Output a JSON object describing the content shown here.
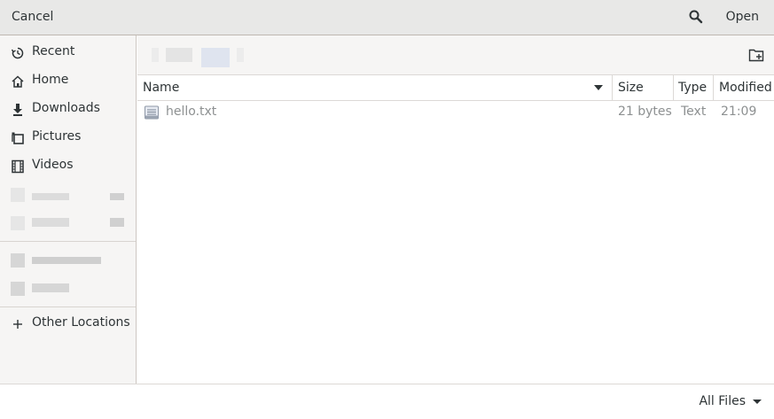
{
  "header": {
    "cancel_label": "Cancel",
    "open_label": "Open"
  },
  "sidebar": {
    "items": [
      {
        "label": "Recent",
        "icon": "recent-icon"
      },
      {
        "label": "Home",
        "icon": "home-icon"
      },
      {
        "label": "Downloads",
        "icon": "downloads-icon"
      },
      {
        "label": "Pictures",
        "icon": "pictures-icon"
      },
      {
        "label": "Videos",
        "icon": "videos-icon"
      }
    ],
    "other_locations_label": "Other Locations"
  },
  "columns": {
    "name": "Name",
    "size": "Size",
    "type": "Type",
    "modified": "Modified"
  },
  "files": [
    {
      "name": "hello.txt",
      "size": "21 bytes",
      "type": "Text",
      "modified": "21:09"
    }
  ],
  "footer": {
    "filter_label": "All Files"
  },
  "colors": {
    "accent": "#2e3436",
    "muted": "#8d9091",
    "sidebar_bg": "#f6f5f4"
  }
}
